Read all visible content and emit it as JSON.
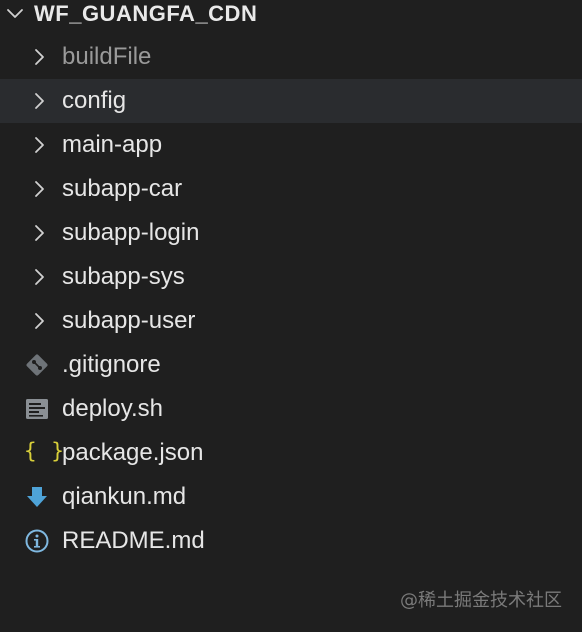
{
  "explorer": {
    "root_title": "WF_GUANGFA_CDN",
    "folders": [
      {
        "label": "buildFile",
        "dimmed": true
      },
      {
        "label": "config",
        "selected": true
      },
      {
        "label": "main-app"
      },
      {
        "label": "subapp-car"
      },
      {
        "label": "subapp-login"
      },
      {
        "label": "subapp-sys"
      },
      {
        "label": "subapp-user"
      }
    ],
    "files": [
      {
        "label": ".gitignore",
        "icon": "git-icon"
      },
      {
        "label": "deploy.sh",
        "icon": "shell-script-icon"
      },
      {
        "label": "package.json",
        "icon": "json-braces-icon",
        "icon_text": "{ }"
      },
      {
        "label": "qiankun.md",
        "icon": "markdown-download-icon"
      },
      {
        "label": "README.md",
        "icon": "info-icon"
      }
    ]
  },
  "watermark": "@稀土掘金技术社区",
  "colors": {
    "background": "#1f1f1f",
    "selected_row": "#2a2c2f",
    "json_icon": "#d8cf3a",
    "markdown_icon": "#4ea3d8",
    "info_icon": "#7fb8e0",
    "git_icon": "#6e7378",
    "shell_icon": "#8a8f94"
  }
}
